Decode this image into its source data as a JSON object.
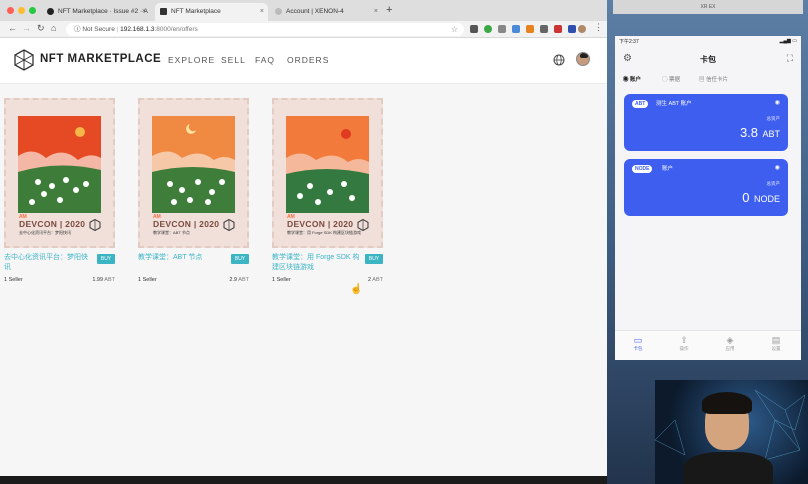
{
  "browser": {
    "tabs": [
      {
        "title": "NFT Marketplace · Issue #2 · A",
        "active": false
      },
      {
        "title": "NFT Marketplace",
        "active": true
      },
      {
        "title": "Account | XENON-4",
        "active": false
      }
    ],
    "url": {
      "security": "Not Secure",
      "host": "192.168.1.3",
      "path": ":8000/en/offers"
    }
  },
  "site": {
    "logo_text": "NFT MARKETPLACE",
    "nav": [
      "EXPLORE",
      "SELL",
      "FAQ",
      "ORDERS"
    ]
  },
  "cards": [
    {
      "poster_year": "AM",
      "poster_title": "DEVCON | 2020",
      "poster_sub": "去中心化资讯平台：梦阳快讯",
      "name": "去中心化资讯平台：梦阳快讯",
      "buy": "BUY",
      "seller": "1 Seller",
      "price": "1.99",
      "unit": "ABT",
      "sky": "#e54a24",
      "hill": "#3e7c3a"
    },
    {
      "poster_year": "AM",
      "poster_title": "DEVCON | 2020",
      "poster_sub": "教学课堂：ABT 节点",
      "name": "教学课堂：ABT 节点",
      "buy": "BUY",
      "seller": "1 Seller",
      "price": "2.9",
      "unit": "ABT",
      "sky": "#f08a43",
      "hill": "#3f7d3b"
    },
    {
      "poster_year": "AM",
      "poster_title": "DEVCON | 2020",
      "poster_sub": "教学课堂：用 Forge SDK 构建区块链游戏",
      "name": "教学课堂：用 Forge SDK 构建区块链游戏",
      "buy": "BUY",
      "seller": "1 Seller",
      "price": "2",
      "unit": "ABT",
      "sky": "#f27a3a",
      "hill": "#347a40"
    }
  ],
  "simulator": {
    "title": "XR EX"
  },
  "phone": {
    "time": "下午2:37",
    "title": "卡包",
    "tabs": [
      "账户",
      "票据",
      "信任卡片"
    ],
    "accounts": [
      {
        "badge": "ABT",
        "name": "测生 ABT 账户",
        "label": "总资产",
        "amount": "3.8",
        "unit": "ABT"
      },
      {
        "badge": "NODE",
        "name": "账户",
        "label": "总资产",
        "amount": "0",
        "unit": "NODE"
      }
    ],
    "bottom_tabs": [
      "卡包",
      "操作",
      "应用",
      "设置"
    ]
  },
  "colors": {
    "accent": "#3bb4c4",
    "wallet_blue": "#3e5ef0",
    "poster_bg": "#f1e0da"
  }
}
